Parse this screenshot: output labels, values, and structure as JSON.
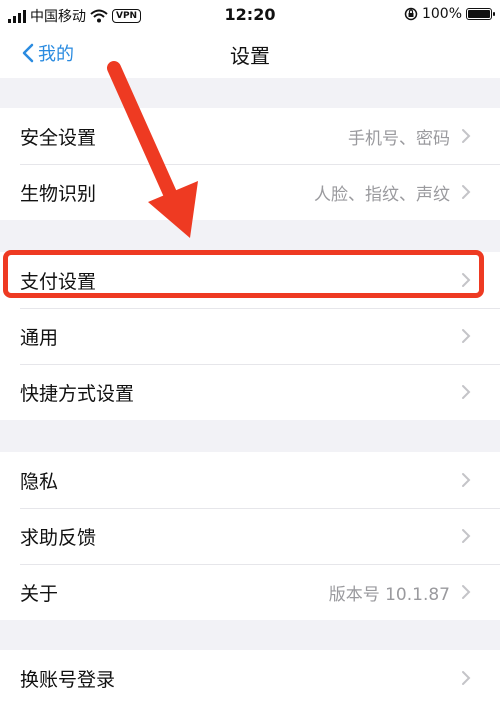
{
  "status_bar": {
    "carrier": "中国移动",
    "vpn": "VPN",
    "time": "12:20",
    "battery": "100%",
    "battery_level": 1.0
  },
  "nav": {
    "back_label": "我的",
    "title": "设置"
  },
  "sections": [
    {
      "items": [
        {
          "label": "安全设置",
          "value": "手机号、密码"
        },
        {
          "label": "生物识别",
          "value": "人脸、指纹、声纹"
        }
      ]
    },
    {
      "items": [
        {
          "label": "支付设置",
          "value": ""
        },
        {
          "label": "通用",
          "value": ""
        },
        {
          "label": "快捷方式设置",
          "value": ""
        }
      ]
    },
    {
      "items": [
        {
          "label": "隐私",
          "value": ""
        },
        {
          "label": "求助反馈",
          "value": ""
        },
        {
          "label": "关于",
          "value": "版本号 10.1.87"
        }
      ]
    },
    {
      "items": [
        {
          "label": "换账号登录",
          "value": ""
        }
      ]
    }
  ],
  "colors": {
    "accent": "#2a8be0",
    "annotation": "#ee3a22",
    "background": "#f2f2f6"
  }
}
